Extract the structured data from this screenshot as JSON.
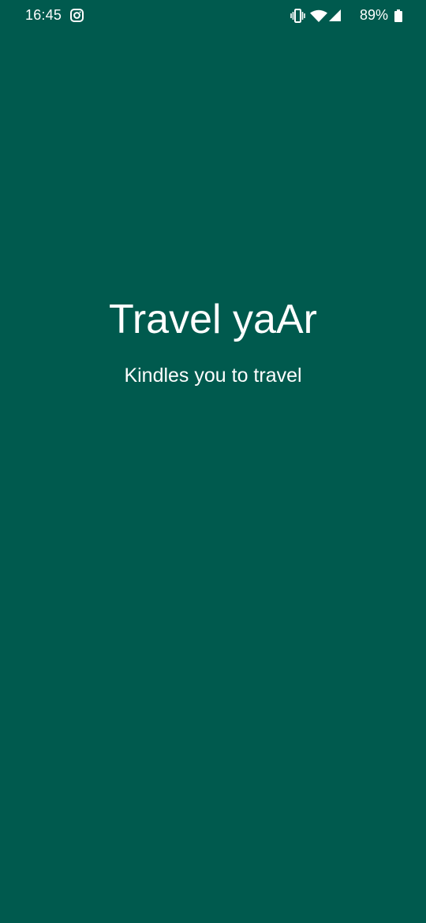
{
  "status_bar": {
    "time": "16:45",
    "battery_percent": "89%",
    "icons": [
      "instagram-icon",
      "vibrate-icon",
      "wifi-icon",
      "signal-icon",
      "battery-icon"
    ]
  },
  "splash": {
    "title": "Travel yaAr",
    "tagline": "Kindles you to travel"
  },
  "colors": {
    "background": "#005A4E",
    "text": "#FFFFFF"
  }
}
